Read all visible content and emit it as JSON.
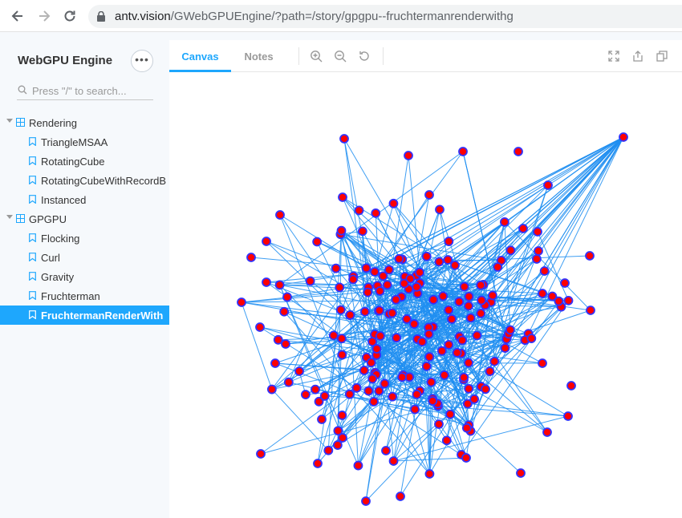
{
  "browser": {
    "url_host": "antv.vision",
    "url_path": "/GWebGPUEngine/?path=/story/gpgpu--fruchtermanrenderwithg"
  },
  "sidebar": {
    "brand": "WebGPU Engine",
    "menu_label": "•••",
    "search_placeholder": "Press \"/\" to search...",
    "groups": [
      {
        "label": "Rendering",
        "items": [
          "TriangleMSAA",
          "RotatingCube",
          "RotatingCubeWithRecordB",
          "Instanced"
        ]
      },
      {
        "label": "GPGPU",
        "items": [
          "Flocking",
          "Curl",
          "Gravity",
          "Fruchterman",
          "FruchtermanRenderWith"
        ]
      }
    ],
    "selected_item": "FruchtermanRenderWith"
  },
  "toolbar": {
    "tabs": [
      "Canvas",
      "Notes"
    ],
    "active_tab": "Canvas",
    "tools": [
      "zoom-in-icon",
      "zoom-out-icon",
      "reset-zoom-icon"
    ],
    "right_tools": [
      "fullscreen-icon",
      "share-icon",
      "copy-icon"
    ]
  },
  "colors": {
    "accent": "#1ea7fd",
    "edge": "#1f8ef1",
    "node_fill": "#ff0000",
    "node_stroke": "#3232ff"
  }
}
